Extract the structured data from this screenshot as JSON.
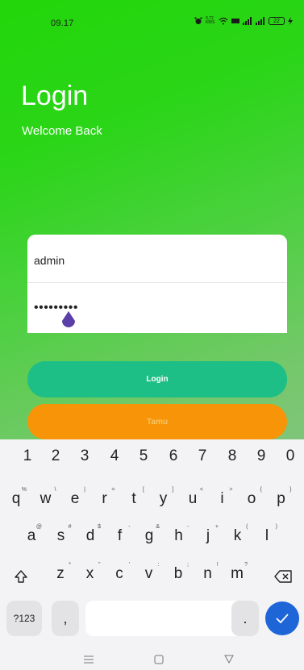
{
  "status_bar": {
    "time": "09.17",
    "net_speed": "0,72 KB/S",
    "battery": "22"
  },
  "login": {
    "title": "Login",
    "subtitle": "Welcome Back",
    "username_value": "admin",
    "password_value": "•••••••••",
    "login_button": "Login",
    "guest_button": "Tamu"
  },
  "keyboard": {
    "numbers": [
      "1",
      "2",
      "3",
      "4",
      "5",
      "6",
      "7",
      "8",
      "9",
      "0"
    ],
    "row1": [
      {
        "k": "q",
        "h": "%"
      },
      {
        "k": "w",
        "h": "\\"
      },
      {
        "k": "e",
        "h": "|"
      },
      {
        "k": "r",
        "h": "="
      },
      {
        "k": "t",
        "h": "["
      },
      {
        "k": "y",
        "h": "]"
      },
      {
        "k": "u",
        "h": "<"
      },
      {
        "k": "i",
        "h": ">"
      },
      {
        "k": "o",
        "h": "{"
      },
      {
        "k": "p",
        "h": "}"
      }
    ],
    "row2": [
      {
        "k": "a",
        "h": "@"
      },
      {
        "k": "s",
        "h": "#"
      },
      {
        "k": "d",
        "h": "$"
      },
      {
        "k": "f",
        "h": "-"
      },
      {
        "k": "g",
        "h": "&"
      },
      {
        "k": "h",
        "h": "-"
      },
      {
        "k": "j",
        "h": "+"
      },
      {
        "k": "k",
        "h": "("
      },
      {
        "k": "l",
        "h": ")"
      }
    ],
    "row3": [
      {
        "k": "z",
        "h": "*"
      },
      {
        "k": "x",
        "h": "\""
      },
      {
        "k": "c",
        "h": "'"
      },
      {
        "k": "v",
        "h": ":"
      },
      {
        "k": "b",
        "h": ";"
      },
      {
        "k": "n",
        "h": "!"
      },
      {
        "k": "m",
        "h": "?"
      }
    ],
    "symbols_key": "?123",
    "comma_key": ",",
    "period_key": "."
  },
  "nav": {
    "menu_icon": "menu-icon",
    "home_icon": "home-icon",
    "back_icon": "back-icon"
  },
  "colors": {
    "login_button": "#1ebf86",
    "guest_button": "#f79407",
    "enter_key": "#1e66d8",
    "accent_handle": "#5b3ea8"
  }
}
